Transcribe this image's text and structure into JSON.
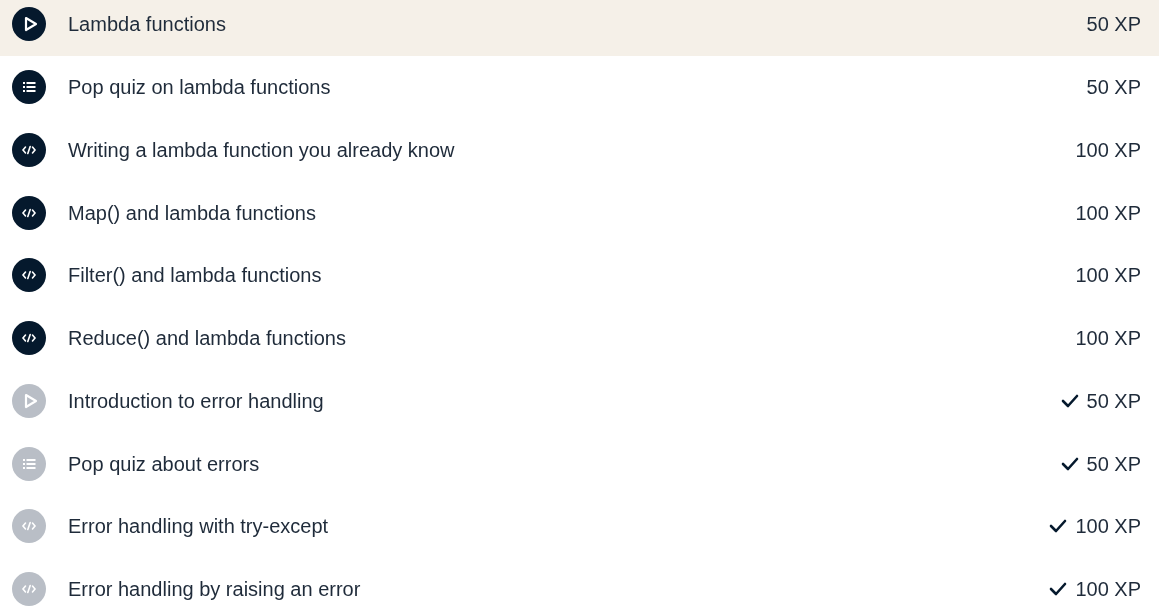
{
  "exercises": [
    {
      "kind": "video",
      "title": "Lambda functions",
      "xp": "50 XP",
      "completed": false,
      "selected": true
    },
    {
      "kind": "quiz",
      "title": "Pop quiz on lambda functions",
      "xp": "50 XP",
      "completed": false,
      "selected": false
    },
    {
      "kind": "code",
      "title": "Writing a lambda function you already know",
      "xp": "100 XP",
      "completed": false,
      "selected": false
    },
    {
      "kind": "code",
      "title": "Map() and lambda functions",
      "xp": "100 XP",
      "completed": false,
      "selected": false
    },
    {
      "kind": "code",
      "title": "Filter() and lambda functions",
      "xp": "100 XP",
      "completed": false,
      "selected": false
    },
    {
      "kind": "code",
      "title": "Reduce() and lambda functions",
      "xp": "100 XP",
      "completed": false,
      "selected": false
    },
    {
      "kind": "video",
      "title": "Introduction to error handling",
      "xp": "50 XP",
      "completed": true,
      "selected": false
    },
    {
      "kind": "quiz",
      "title": "Pop quiz about errors",
      "xp": "50 XP",
      "completed": true,
      "selected": false
    },
    {
      "kind": "code",
      "title": "Error handling with try-except",
      "xp": "100 XP",
      "completed": true,
      "selected": false
    },
    {
      "kind": "code",
      "title": "Error handling by raising an error",
      "xp": "100 XP",
      "completed": true,
      "selected": false
    }
  ]
}
